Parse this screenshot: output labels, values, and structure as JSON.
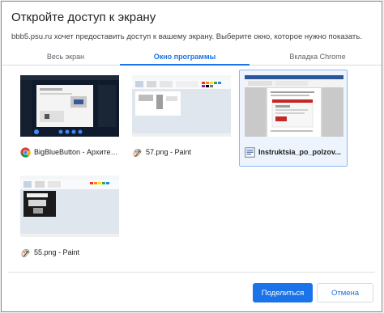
{
  "dialog": {
    "title": "Откройте доступ к экрану",
    "subtitle": "bbb5.psu.ru хочет предоставить доступ к вашему экрану. Выберите окно, которое нужно показать."
  },
  "tabs": [
    {
      "label": "Весь экран",
      "active": false
    },
    {
      "label": "Окно программы",
      "active": true
    },
    {
      "label": "Вкладка Chrome",
      "active": false
    }
  ],
  "windows": [
    {
      "label": "BigBlueButton - Архитект...",
      "icon": "chrome-icon",
      "selected": false
    },
    {
      "label": "57.png - Paint",
      "icon": "paint-icon",
      "selected": false
    },
    {
      "label": "Instruktsia_po_polzov...",
      "icon": "word-doc-icon",
      "selected": true
    },
    {
      "label": "55.png - Paint",
      "icon": "paint-icon",
      "selected": false
    }
  ],
  "buttons": {
    "share": "Поделиться",
    "cancel": "Отмена"
  },
  "colors": {
    "accent": "#1a73e8",
    "selected_border": "#8ab4f8"
  }
}
